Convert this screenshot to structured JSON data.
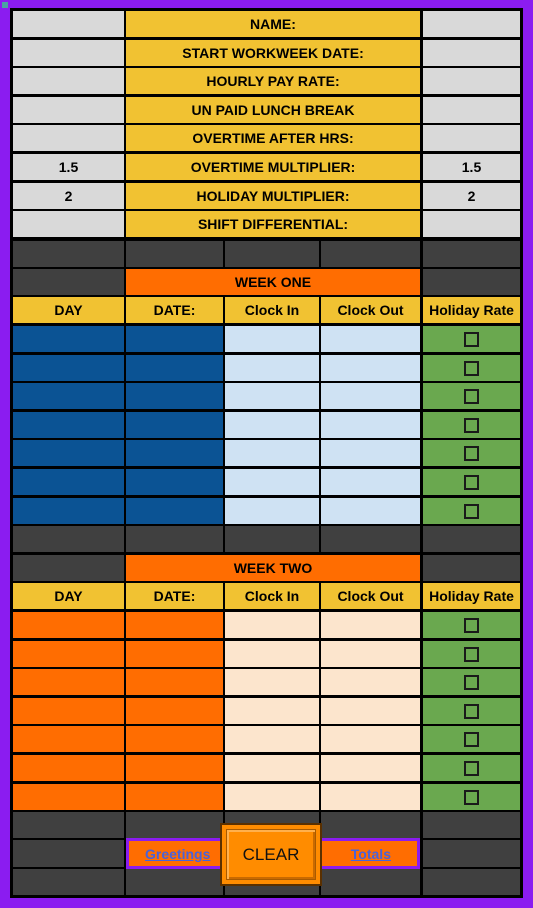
{
  "info_labels": [
    "NAME:",
    "START WORKWEEK DATE:",
    "HOURLY PAY RATE:",
    "UN PAID LUNCH BREAK",
    "OVERTIME AFTER HRS:",
    "OVERTIME MULTIPLIER:",
    "HOLIDAY MULTIPLIER:",
    "SHIFT DIFFERENTIAL:"
  ],
  "info_left_values": [
    "",
    "",
    "",
    "",
    "",
    "1.5",
    "2",
    ""
  ],
  "info_right_values": [
    "",
    "",
    "",
    "",
    "",
    "1.5",
    "2",
    ""
  ],
  "week_one": {
    "title": "WEEK ONE",
    "headers": [
      "DAY",
      "DATE:",
      "Clock In",
      "Clock Out",
      "Holiday Rate"
    ]
  },
  "week_two": {
    "title": "WEEK TWO",
    "headers": [
      "DAY",
      "DATE:",
      "Clock In",
      "Clock Out",
      "Holiday Rate"
    ]
  },
  "nav": {
    "greetings_label": "Greetings",
    "clear_label": "CLEAR",
    "totals_label": "Totals"
  },
  "colors": {
    "frame": "#8b1cf0",
    "gold": "#f1c232",
    "orange": "#ff6d01",
    "blue": "#0b5394",
    "light_blue": "#cfe2f3",
    "peach": "#fce5cd",
    "green": "#6aa84f",
    "dark": "#404040"
  }
}
